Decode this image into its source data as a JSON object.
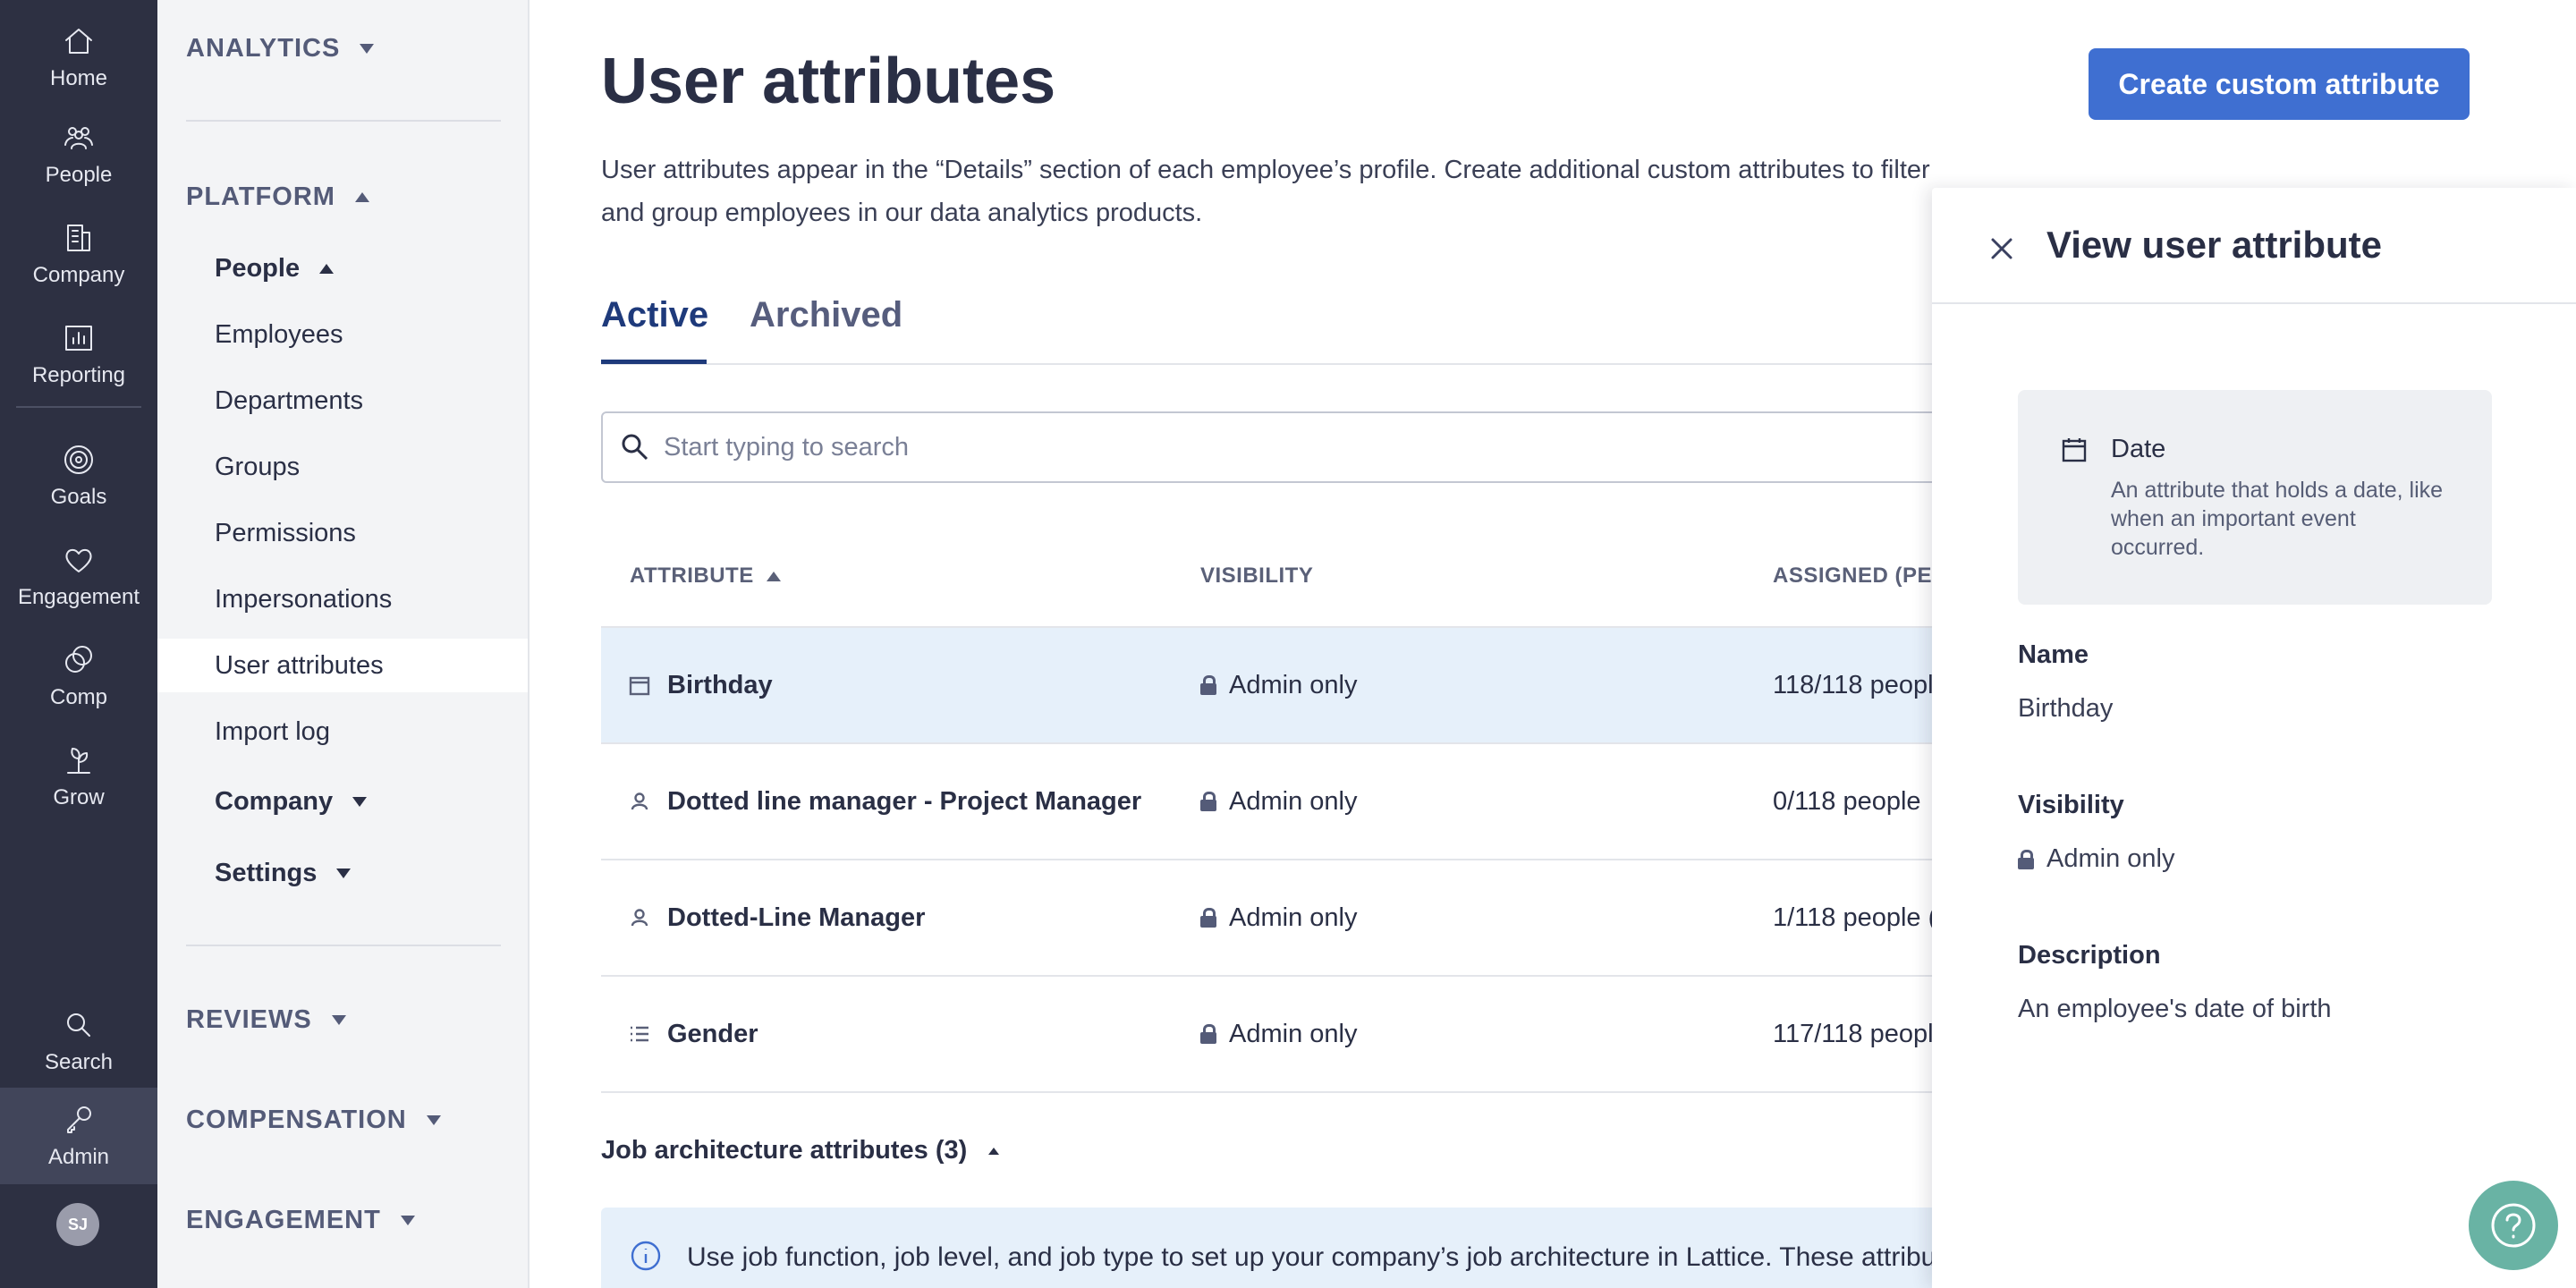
{
  "rail": {
    "home": "Home",
    "people": "People",
    "company": "Company",
    "reporting": "Reporting",
    "goals": "Goals",
    "engagement": "Engagement",
    "comp": "Comp",
    "grow": "Grow",
    "search": "Search",
    "admin": "Admin",
    "avatar_initials": "SJ"
  },
  "subnav": {
    "analytics": "ANALYTICS",
    "platform": "PLATFORM",
    "people": "People",
    "items": [
      "Employees",
      "Departments",
      "Groups",
      "Permissions",
      "Impersonations",
      "User attributes",
      "Import log"
    ],
    "active_item": "User attributes",
    "company": "Company",
    "settings": "Settings",
    "reviews": "REVIEWS",
    "compensation": "COMPENSATION",
    "engagement": "ENGAGEMENT"
  },
  "main": {
    "title": "User attributes",
    "create_button": "Create custom attribute",
    "description": "User attributes appear in the “Details” section of each employee’s profile. Create additional custom attributes to filter and group employees in our data analytics products.",
    "tabs": {
      "active": "Active",
      "archived": "Archived"
    },
    "search_placeholder": "Start typing to search",
    "columns": {
      "attribute": "ATTRIBUTE",
      "visibility": "VISIBILITY",
      "assigned": "ASSIGNED (PEC"
    },
    "rows": [
      {
        "name": "Birthday",
        "icon": "calendar-icon",
        "visibility": "Admin only",
        "assigned": "118/118 peopl"
      },
      {
        "name": "Dotted line manager - Project Manager",
        "icon": "person-icon",
        "visibility": "Admin only",
        "assigned": "0/118 people"
      },
      {
        "name": "Dotted-Line Manager",
        "icon": "person-icon",
        "visibility": "Admin only",
        "assigned": "1/118 people ("
      },
      {
        "name": "Gender",
        "icon": "list-icon",
        "visibility": "Admin only",
        "assigned": "117/118 peopl"
      }
    ],
    "job_section": "Job architecture attributes (3)",
    "info_text": "Use job function, job level, and job type to set up your company’s job architecture in Lattice. These attribu"
  },
  "drawer": {
    "title": "View user attribute",
    "type_name": "Date",
    "type_desc": "An attribute that holds a date, like when an important event occurred.",
    "name_label": "Name",
    "name_value": "Birthday",
    "visibility_label": "Visibility",
    "visibility_value": "Admin only",
    "description_label": "Description",
    "description_value": "An employee's date of birth"
  },
  "colors": {
    "rail_bg": "#2d3042",
    "accent": "#3f6fd1",
    "selected_row": "#e6f0fa",
    "help": "#69b3a4"
  }
}
